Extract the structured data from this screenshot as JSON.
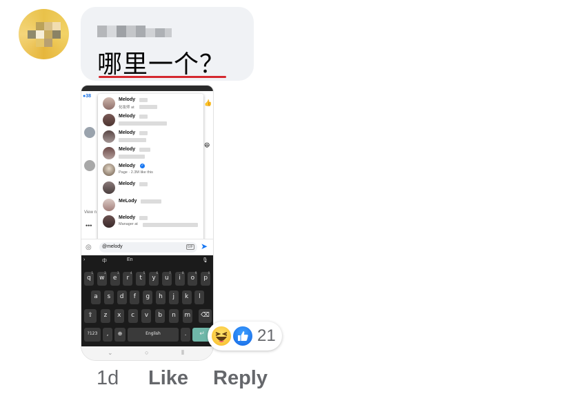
{
  "comment": {
    "text": "哪里一个？",
    "timestamp": "1d",
    "like_label": "Like",
    "reply_label": "Reply",
    "reaction_count": "21",
    "reactions": [
      "haha-icon",
      "like-icon"
    ],
    "accent_underline": "#d4282e"
  },
  "screenshot": {
    "top_count": "38",
    "mention_suggestions": [
      {
        "name": "Melody",
        "sub": "化妆师 at"
      },
      {
        "name": "Melody",
        "sub": ""
      },
      {
        "name": "Melody",
        "sub": ""
      },
      {
        "name": "Melody",
        "sub": ""
      },
      {
        "name": "Melody",
        "sub": "Page · 2.3M like this",
        "verified": true
      },
      {
        "name": "Melody",
        "sub": ""
      },
      {
        "name": "MeLody",
        "sub": ""
      },
      {
        "name": "Melody",
        "sub": "Manager at"
      }
    ],
    "left_hint": "View n",
    "input_value": "@melody",
    "gif_label": "GIF",
    "keyboard": {
      "lang_cn": "中",
      "lang_en": "En",
      "row1": [
        "q",
        "w",
        "e",
        "r",
        "t",
        "y",
        "u",
        "i",
        "o",
        "p"
      ],
      "row1_nums": [
        "1",
        "2",
        "3",
        "4",
        "5",
        "6",
        "7",
        "8",
        "9",
        "0"
      ],
      "row2": [
        "a",
        "s",
        "d",
        "f",
        "g",
        "h",
        "j",
        "k",
        "l"
      ],
      "row3": [
        "z",
        "x",
        "c",
        "v",
        "b",
        "n",
        "m"
      ],
      "mode_key": "?123",
      "space_label": "English"
    }
  }
}
